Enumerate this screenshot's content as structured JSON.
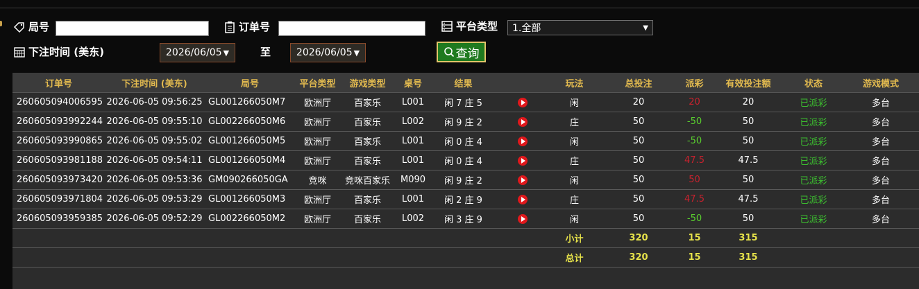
{
  "filters": {
    "round_label": "局号",
    "round_value": "",
    "order_label": "订单号",
    "order_value": "",
    "platform_label": "平台类型",
    "platform_selected": "1.全部",
    "bet_time_label": "下注时间 (美东)",
    "date_from": "2026/06/05",
    "to_label": "至",
    "date_to": "2026/06/05",
    "query_label": "查询"
  },
  "colors": {
    "header_text": "#e2ba4f",
    "loss": "#c8222e",
    "win": "#5ad02f",
    "status": "#3cbf2f",
    "summary": "#e6e24a"
  },
  "table": {
    "headers": [
      "订单号",
      "下注时间 (美东)",
      "局号",
      "平台类型",
      "游戏类型",
      "桌号",
      "结果",
      "",
      "玩法",
      "总投注",
      "派彩",
      "有效投注额",
      "状态",
      "游戏模式"
    ],
    "rows": [
      {
        "order": "260605094006595",
        "time": "2026-06-05 09:56:25",
        "round": "GL001266050M7",
        "platform": "欧洲厅",
        "game": "百家乐",
        "table": "L001",
        "result": "闲 7 庄 5",
        "play_icon": "play-video-icon",
        "play": "闲",
        "bet": "20",
        "payout": "20",
        "payout_type": "loss",
        "valid": "20",
        "status": "已派彩",
        "mode": "多台"
      },
      {
        "order": "260605093992244",
        "time": "2026-06-05 09:55:10",
        "round": "GL002266050M6",
        "platform": "欧洲厅",
        "game": "百家乐",
        "table": "L002",
        "result": "闲 9 庄 2",
        "play_icon": "play-video-icon",
        "play": "庄",
        "bet": "50",
        "payout": "-50",
        "payout_type": "win",
        "valid": "50",
        "status": "已派彩",
        "mode": "多台"
      },
      {
        "order": "260605093990865",
        "time": "2026-06-05 09:55:02",
        "round": "GL001266050M5",
        "platform": "欧洲厅",
        "game": "百家乐",
        "table": "L001",
        "result": "闲 0 庄 4",
        "play_icon": "play-video-icon",
        "play": "闲",
        "bet": "50",
        "payout": "-50",
        "payout_type": "win",
        "valid": "50",
        "status": "已派彩",
        "mode": "多台"
      },
      {
        "order": "260605093981188",
        "time": "2026-06-05 09:54:11",
        "round": "GL001266050M4",
        "platform": "欧洲厅",
        "game": "百家乐",
        "table": "L001",
        "result": "闲 0 庄 4",
        "play_icon": "play-video-icon",
        "play": "庄",
        "bet": "50",
        "payout": "47.5",
        "payout_type": "loss",
        "valid": "47.5",
        "status": "已派彩",
        "mode": "多台"
      },
      {
        "order": "260605093973420",
        "time": "2026-06-05 09:53:36",
        "round": "GM090266050GA",
        "platform": "竞咪",
        "game": "竞咪百家乐",
        "table": "M090",
        "result": "闲 9 庄 2",
        "play_icon": "play-video-icon",
        "play": "闲",
        "bet": "50",
        "payout": "50",
        "payout_type": "loss",
        "valid": "50",
        "status": "已派彩",
        "mode": "多台"
      },
      {
        "order": "260605093971804",
        "time": "2026-06-05 09:53:29",
        "round": "GL001266050M3",
        "platform": "欧洲厅",
        "game": "百家乐",
        "table": "L001",
        "result": "闲 2 庄 9",
        "play_icon": "play-video-icon",
        "play": "庄",
        "bet": "50",
        "payout": "47.5",
        "payout_type": "loss",
        "valid": "47.5",
        "status": "已派彩",
        "mode": "多台"
      },
      {
        "order": "260605093959385",
        "time": "2026-06-05 09:52:29",
        "round": "GL002266050M2",
        "platform": "欧洲厅",
        "game": "百家乐",
        "table": "L002",
        "result": "闲 3 庄 9",
        "play_icon": "play-video-icon",
        "play": "闲",
        "bet": "50",
        "payout": "-50",
        "payout_type": "win",
        "valid": "50",
        "status": "已派彩",
        "mode": "多台"
      }
    ],
    "subtotal": {
      "label": "小计",
      "bet": "320",
      "payout": "15",
      "valid": "315"
    },
    "total": {
      "label": "总计",
      "bet": "320",
      "payout": "15",
      "valid": "315"
    }
  }
}
